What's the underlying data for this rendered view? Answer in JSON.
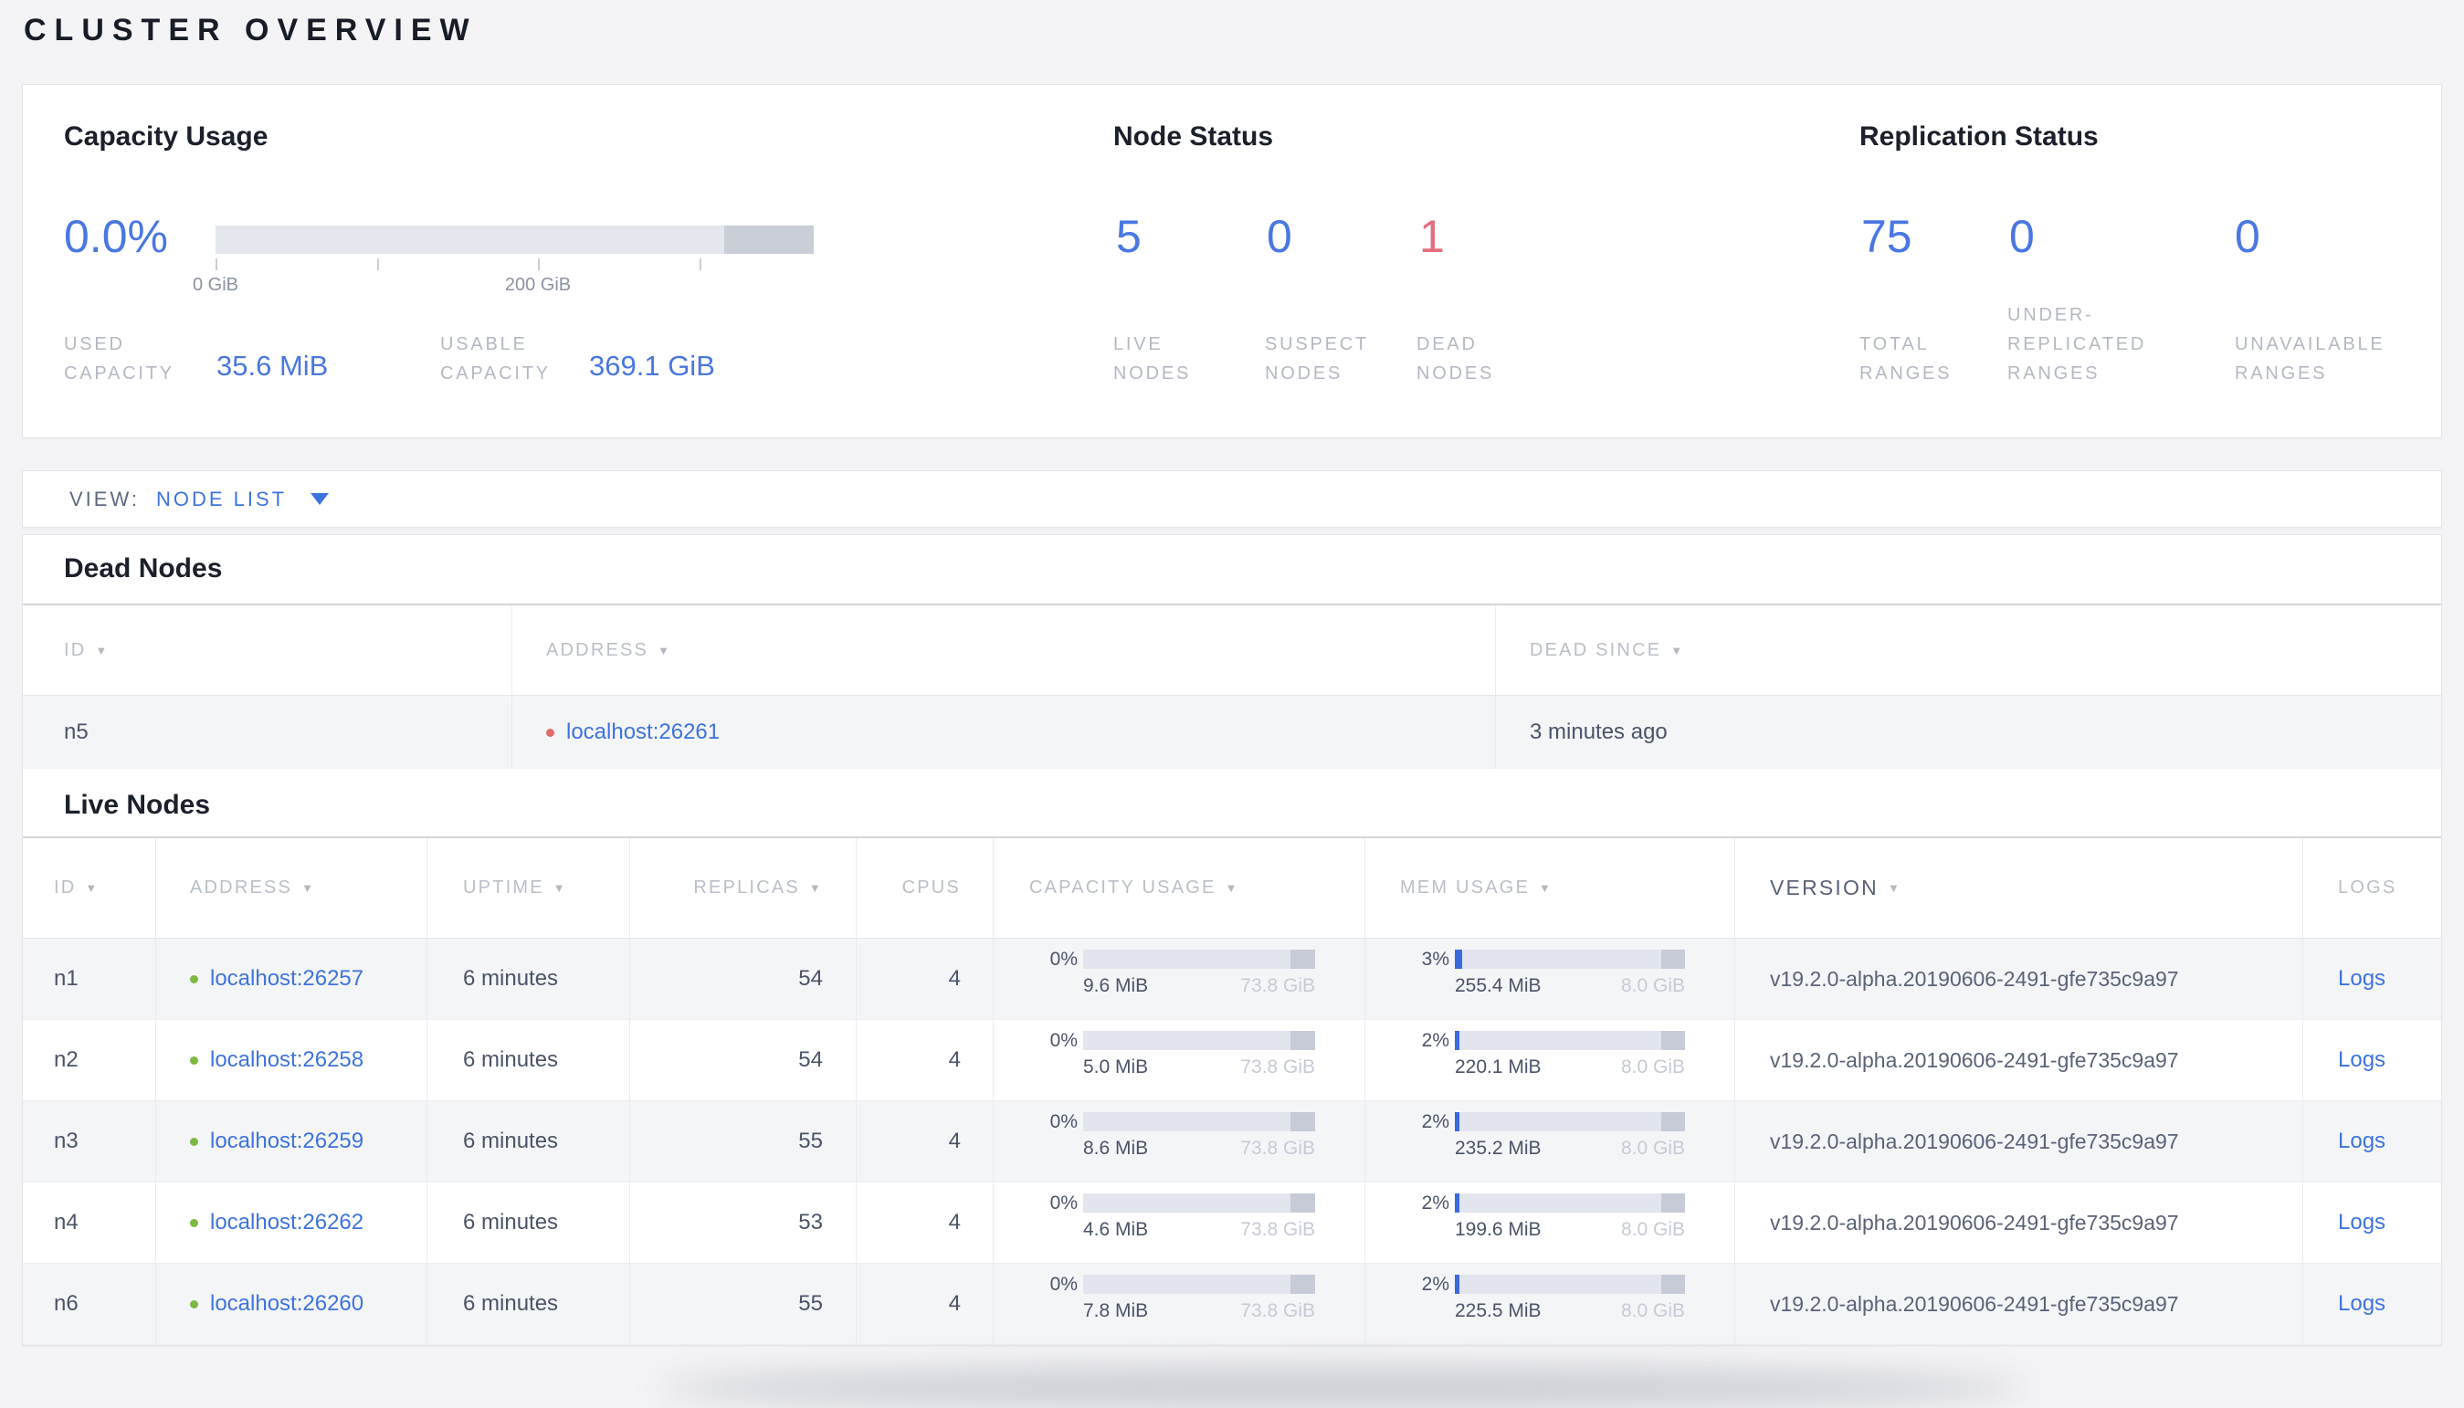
{
  "page_title": "CLUSTER OVERVIEW",
  "colors": {
    "accent_blue": "#4a77e0",
    "link_blue": "#3d73dd",
    "danger_red": "#e26e80",
    "live_green": "#7db843",
    "dead_dot_red": "#e16b6b"
  },
  "capacity": {
    "title": "Capacity Usage",
    "percent": "0.0%",
    "axis_start": "0 GiB",
    "axis_mid": "200 GiB",
    "used": {
      "l1": "",
      "l2": "USED",
      "l3": "CAPACITY",
      "value": "35.6 MiB"
    },
    "usable": {
      "l1": "",
      "l2": "USABLE",
      "l3": "CAPACITY",
      "value": "369.1 GiB"
    }
  },
  "node_status": {
    "title": "Node Status",
    "stats": [
      {
        "value": "5",
        "l1": "",
        "l2": "LIVE",
        "l3": "NODES"
      },
      {
        "value": "0",
        "l1": "",
        "l2": "SUSPECT",
        "l3": "NODES"
      },
      {
        "value": "1",
        "l1": "",
        "l2": "DEAD",
        "l3": "NODES"
      }
    ]
  },
  "replication_status": {
    "title": "Replication Status",
    "stats": [
      {
        "value": "75",
        "l1": "",
        "l2": "TOTAL",
        "l3": "RANGES"
      },
      {
        "value": "0",
        "l1": "UNDER-",
        "l2": "REPLICATED",
        "l3": "RANGES"
      },
      {
        "value": "0",
        "l1": "",
        "l2": "UNAVAILABLE",
        "l3": "RANGES"
      }
    ]
  },
  "view_bar": {
    "label": "VIEW:",
    "value": "NODE LIST"
  },
  "dead_nodes": {
    "title": "Dead Nodes",
    "columns": [
      {
        "label": "ID",
        "sortable": true
      },
      {
        "label": "ADDRESS",
        "sortable": true
      },
      {
        "label": "DEAD SINCE",
        "sortable": true
      }
    ],
    "rows": [
      {
        "id": "n5",
        "address": "localhost:26261",
        "dead_since": "3 minutes ago"
      }
    ]
  },
  "live_nodes": {
    "title": "Live Nodes",
    "columns": [
      {
        "label": "ID",
        "sortable": true
      },
      {
        "label": "ADDRESS",
        "sortable": true
      },
      {
        "label": "UPTIME",
        "sortable": true
      },
      {
        "label": "REPLICAS",
        "sortable": true
      },
      {
        "label": "CPUS",
        "sortable": false
      },
      {
        "label": "CAPACITY USAGE",
        "sortable": true
      },
      {
        "label": "MEM USAGE",
        "sortable": true
      },
      {
        "label": "VERSION",
        "sortable": true
      },
      {
        "label": "LOGS",
        "sortable": false
      }
    ],
    "rows": [
      {
        "id": "n1",
        "address": "localhost:26257",
        "uptime": "6 minutes",
        "replicas": "54",
        "cpus": "4",
        "cap_pct": "0%",
        "cap_fill": 0,
        "cap_used": "9.6 MiB",
        "cap_total": "73.8 GiB",
        "mem_pct": "3%",
        "mem_fill": 3,
        "mem_used": "255.4 MiB",
        "mem_total": "8.0 GiB",
        "version": "v19.2.0-alpha.20190606-2491-gfe735c9a97",
        "logs_label": "Logs"
      },
      {
        "id": "n2",
        "address": "localhost:26258",
        "uptime": "6 minutes",
        "replicas": "54",
        "cpus": "4",
        "cap_pct": "0%",
        "cap_fill": 0,
        "cap_used": "5.0 MiB",
        "cap_total": "73.8 GiB",
        "mem_pct": "2%",
        "mem_fill": 2,
        "mem_used": "220.1 MiB",
        "mem_total": "8.0 GiB",
        "version": "v19.2.0-alpha.20190606-2491-gfe735c9a97",
        "logs_label": "Logs"
      },
      {
        "id": "n3",
        "address": "localhost:26259",
        "uptime": "6 minutes",
        "replicas": "55",
        "cpus": "4",
        "cap_pct": "0%",
        "cap_fill": 0,
        "cap_used": "8.6 MiB",
        "cap_total": "73.8 GiB",
        "mem_pct": "2%",
        "mem_fill": 2,
        "mem_used": "235.2 MiB",
        "mem_total": "8.0 GiB",
        "version": "v19.2.0-alpha.20190606-2491-gfe735c9a97",
        "logs_label": "Logs"
      },
      {
        "id": "n4",
        "address": "localhost:26262",
        "uptime": "6 minutes",
        "replicas": "53",
        "cpus": "4",
        "cap_pct": "0%",
        "cap_fill": 0,
        "cap_used": "4.6 MiB",
        "cap_total": "73.8 GiB",
        "mem_pct": "2%",
        "mem_fill": 2,
        "mem_used": "199.6 MiB",
        "mem_total": "8.0 GiB",
        "version": "v19.2.0-alpha.20190606-2491-gfe735c9a97",
        "logs_label": "Logs"
      },
      {
        "id": "n6",
        "address": "localhost:26260",
        "uptime": "6 minutes",
        "replicas": "55",
        "cpus": "4",
        "cap_pct": "0%",
        "cap_fill": 0,
        "cap_used": "7.8 MiB",
        "cap_total": "73.8 GiB",
        "mem_pct": "2%",
        "mem_fill": 2,
        "mem_used": "225.5 MiB",
        "mem_total": "8.0 GiB",
        "version": "v19.2.0-alpha.20190606-2491-gfe735c9a97",
        "logs_label": "Logs"
      }
    ]
  }
}
